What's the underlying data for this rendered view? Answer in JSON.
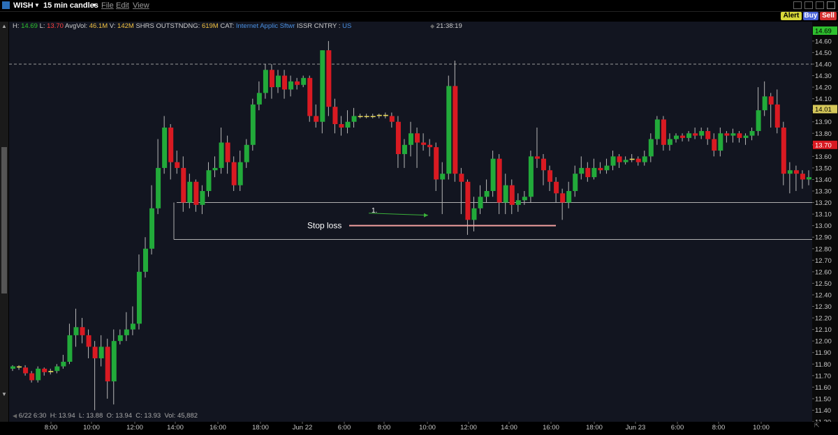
{
  "titlebar": {
    "symbol": "WISH",
    "interval": "15 min candles",
    "menus": [
      "File",
      "Edit",
      "View"
    ]
  },
  "actions": {
    "alert": "Alert",
    "buy": "Buy",
    "sell": "Sell"
  },
  "info": {
    "h_label": "H:",
    "h": "14.69",
    "l_label": "L:",
    "l": "13.70",
    "avgvol_label": "AvgVol:",
    "avgvol": "46.1M",
    "v_label": "V:",
    "v": "142M",
    "shrs_label": "SHRS OUTSTNDNG:",
    "shrs": "619M",
    "cat_label": "CAT:",
    "cat": "Internet Applic Sftwr",
    "issr_label": "ISSR CNTRY :",
    "issr": "US",
    "time": "21:38:19"
  },
  "bottom_info": {
    "date": "6/22 6:30",
    "h": "H: 13.94",
    "l": "L: 13.88",
    "o": "O: 13.94",
    "c": "C: 13.93",
    "vol": "Vol: 45,882"
  },
  "annotations": {
    "stop_loss": "Stop loss",
    "marker": "1."
  },
  "price_badges": {
    "high": "14.69",
    "current": "14.01",
    "low": "13.70"
  },
  "colors": {
    "up": "#22aa3a",
    "down": "#d91a22",
    "background": "#121520",
    "stop_line": "#f2a0a0",
    "high_badge": "#2ec02e",
    "current_badge": "#d6c85a",
    "low_badge": "#d91a22"
  },
  "chart_data": {
    "type": "candlestick",
    "ylim": [
      11.3,
      14.72
    ],
    "y_ticks": [
      "14.60",
      "14.50",
      "14.40",
      "14.30",
      "14.20",
      "14.10",
      "14.00",
      "13.90",
      "13.80",
      "13.70",
      "13.60",
      "13.50",
      "13.40",
      "13.30",
      "13.20",
      "13.10",
      "13.00",
      "12.90",
      "12.80",
      "12.70",
      "12.60",
      "12.50",
      "12.40",
      "12.30",
      "12.20",
      "12.10",
      "12.00",
      "11.90",
      "11.80",
      "11.70",
      "11.60",
      "11.50",
      "11.40",
      "11.30"
    ],
    "x_ticks": [
      "8:00",
      "10:00",
      "12:00",
      "14:00",
      "16:00",
      "18:00",
      "Jun 22",
      "6:00",
      "8:00",
      "10:00",
      "12:00",
      "14:00",
      "16:00",
      "18:00",
      "Jun 23",
      "6:00",
      "8:00",
      "10:00"
    ],
    "reference_lines": {
      "dashed_high": 14.4,
      "support_upper": 13.2,
      "support_lower": 12.88,
      "stop_loss": 13.0
    },
    "candles": [
      [
        11.76,
        11.78,
        11.74,
        11.79
      ],
      [
        11.78,
        11.77,
        11.75,
        11.79
      ],
      [
        11.77,
        11.72,
        11.7,
        11.79
      ],
      [
        11.72,
        11.66,
        11.64,
        11.74
      ],
      [
        11.66,
        11.76,
        11.64,
        11.78
      ],
      [
        11.76,
        11.73,
        11.7,
        11.77
      ],
      [
        11.73,
        11.74,
        11.71,
        11.76
      ],
      [
        11.74,
        11.78,
        11.72,
        11.8
      ],
      [
        11.78,
        11.82,
        11.76,
        11.88
      ],
      [
        11.82,
        12.05,
        11.8,
        12.15
      ],
      [
        12.05,
        12.12,
        11.95,
        12.28
      ],
      [
        12.12,
        12.05,
        11.98,
        12.2
      ],
      [
        12.05,
        11.95,
        11.85,
        12.1
      ],
      [
        11.95,
        11.85,
        11.4,
        12.0
      ],
      [
        11.85,
        11.95,
        11.78,
        12.05
      ],
      [
        11.95,
        11.65,
        11.5,
        12.02
      ],
      [
        11.65,
        12.0,
        11.45,
        12.1
      ],
      [
        12.0,
        12.05,
        11.97,
        12.1
      ],
      [
        12.05,
        12.1,
        12.0,
        12.25
      ],
      [
        12.1,
        12.15,
        12.05,
        12.3
      ],
      [
        12.15,
        12.6,
        12.1,
        12.75
      ],
      [
        12.6,
        12.8,
        12.55,
        12.9
      ],
      [
        12.8,
        13.15,
        12.75,
        13.35
      ],
      [
        13.15,
        13.5,
        13.1,
        13.75
      ],
      [
        13.5,
        13.85,
        13.45,
        13.95
      ],
      [
        13.85,
        13.55,
        13.4,
        13.88
      ],
      [
        13.55,
        13.5,
        13.45,
        13.65
      ],
      [
        13.5,
        13.2,
        13.12,
        13.6
      ],
      [
        13.2,
        13.38,
        13.15,
        13.45
      ],
      [
        13.38,
        13.18,
        13.12,
        13.4
      ],
      [
        13.18,
        13.3,
        13.1,
        13.35
      ],
      [
        13.3,
        13.48,
        13.25,
        13.55
      ],
      [
        13.48,
        13.5,
        13.42,
        13.6
      ],
      [
        13.5,
        13.72,
        13.45,
        13.85
      ],
      [
        13.72,
        13.55,
        13.45,
        13.78
      ],
      [
        13.55,
        13.35,
        13.3,
        13.6
      ],
      [
        13.35,
        13.55,
        13.3,
        13.65
      ],
      [
        13.55,
        13.7,
        13.5,
        13.75
      ],
      [
        13.7,
        14.05,
        13.65,
        14.1
      ],
      [
        14.05,
        14.15,
        14.0,
        14.25
      ],
      [
        14.15,
        14.35,
        14.1,
        14.4
      ],
      [
        14.35,
        14.2,
        14.1,
        14.4
      ],
      [
        14.2,
        14.3,
        14.15,
        14.35
      ],
      [
        14.3,
        14.18,
        14.1,
        14.35
      ],
      [
        14.18,
        14.25,
        14.12,
        14.3
      ],
      [
        14.25,
        14.22,
        14.18,
        14.28
      ],
      [
        14.22,
        14.28,
        14.2,
        14.3
      ],
      [
        14.28,
        13.95,
        13.9,
        14.3
      ],
      [
        13.95,
        13.9,
        13.85,
        14.05
      ],
      [
        13.9,
        14.52,
        13.8,
        14.52
      ],
      [
        14.52,
        14.03,
        13.95,
        14.6
      ],
      [
        14.03,
        13.88,
        13.8,
        14.1
      ],
      [
        13.88,
        13.85,
        13.78,
        13.95
      ],
      [
        13.85,
        13.9,
        13.8,
        14.0
      ],
      [
        13.9,
        13.95,
        13.85,
        14.02
      ],
      [
        13.95,
        13.95,
        13.93,
        13.97
      ],
      [
        13.95,
        13.95,
        13.93,
        13.97
      ],
      [
        13.95,
        13.95,
        13.93,
        13.97
      ],
      [
        13.95,
        13.96,
        13.93,
        13.97
      ],
      [
        13.96,
        13.95,
        13.93,
        13.98
      ],
      [
        13.95,
        13.9,
        13.85,
        13.98
      ],
      [
        13.9,
        13.62,
        13.5,
        13.95
      ],
      [
        13.62,
        13.7,
        13.5,
        13.75
      ],
      [
        13.7,
        13.8,
        13.6,
        13.9
      ],
      [
        13.8,
        13.72,
        13.5,
        13.85
      ],
      [
        13.72,
        13.7,
        13.65,
        13.8
      ],
      [
        13.7,
        13.68,
        13.6,
        13.75
      ],
      [
        13.68,
        13.4,
        13.3,
        13.72
      ],
      [
        13.4,
        13.45,
        13.1,
        13.55
      ],
      [
        13.45,
        14.21,
        13.4,
        14.3
      ],
      [
        14.21,
        13.45,
        13.38,
        14.43
      ],
      [
        13.45,
        13.38,
        13.1,
        13.5
      ],
      [
        13.38,
        13.05,
        12.92,
        13.4
      ],
      [
        13.05,
        13.15,
        12.95,
        13.25
      ],
      [
        13.15,
        13.25,
        13.1,
        13.35
      ],
      [
        13.25,
        13.3,
        13.2,
        13.4
      ],
      [
        13.3,
        13.58,
        13.25,
        13.65
      ],
      [
        13.58,
        13.2,
        13.1,
        13.62
      ],
      [
        13.2,
        13.35,
        13.1,
        13.45
      ],
      [
        13.35,
        13.18,
        13.1,
        13.4
      ],
      [
        13.18,
        13.22,
        13.12,
        13.28
      ],
      [
        13.22,
        13.25,
        13.18,
        13.3
      ],
      [
        13.25,
        13.6,
        13.2,
        13.65
      ],
      [
        13.6,
        13.58,
        13.5,
        13.85
      ],
      [
        13.58,
        13.48,
        13.35,
        13.62
      ],
      [
        13.48,
        13.38,
        13.3,
        13.52
      ],
      [
        13.38,
        13.28,
        13.2,
        13.42
      ],
      [
        13.28,
        13.2,
        13.05,
        13.32
      ],
      [
        13.2,
        13.3,
        13.15,
        13.38
      ],
      [
        13.3,
        13.45,
        13.25,
        13.52
      ],
      [
        13.45,
        13.5,
        13.4,
        13.6
      ],
      [
        13.5,
        13.42,
        13.38,
        13.55
      ],
      [
        13.42,
        13.5,
        13.4,
        13.58
      ],
      [
        13.5,
        13.48,
        13.45,
        13.55
      ],
      [
        13.48,
        13.52,
        13.45,
        13.58
      ],
      [
        13.52,
        13.6,
        13.48,
        13.65
      ],
      [
        13.6,
        13.55,
        13.5,
        13.62
      ],
      [
        13.55,
        13.57,
        13.53,
        13.6
      ],
      [
        13.57,
        13.58,
        13.55,
        13.62
      ],
      [
        13.58,
        13.55,
        13.52,
        13.6
      ],
      [
        13.55,
        13.6,
        13.52,
        13.65
      ],
      [
        13.6,
        13.75,
        13.55,
        13.8
      ],
      [
        13.75,
        13.92,
        13.7,
        13.95
      ],
      [
        13.92,
        13.7,
        13.65,
        13.95
      ],
      [
        13.7,
        13.75,
        13.65,
        13.8
      ],
      [
        13.75,
        13.78,
        13.72,
        13.8
      ],
      [
        13.78,
        13.76,
        13.73,
        13.8
      ],
      [
        13.76,
        13.8,
        13.73,
        13.82
      ],
      [
        13.8,
        13.78,
        13.75,
        13.85
      ],
      [
        13.78,
        13.82,
        13.75,
        13.85
      ],
      [
        13.82,
        13.75,
        13.7,
        13.85
      ],
      [
        13.75,
        13.65,
        13.6,
        13.8
      ],
      [
        13.65,
        13.8,
        13.6,
        13.85
      ],
      [
        13.8,
        13.78,
        13.72,
        13.82
      ],
      [
        13.78,
        13.8,
        13.72,
        13.84
      ],
      [
        13.8,
        13.76,
        13.72,
        13.82
      ],
      [
        13.76,
        13.78,
        13.7,
        13.8
      ],
      [
        13.78,
        13.82,
        13.74,
        13.85
      ],
      [
        13.82,
        14.0,
        13.78,
        14.2
      ],
      [
        14.0,
        14.12,
        13.95,
        14.25
      ],
      [
        14.12,
        14.05,
        13.85,
        14.15
      ],
      [
        14.05,
        13.85,
        13.8,
        14.18
      ],
      [
        13.85,
        13.45,
        13.35,
        13.9
      ],
      [
        13.45,
        13.48,
        13.28,
        13.55
      ],
      [
        13.48,
        13.45,
        13.3,
        13.52
      ],
      [
        13.45,
        13.4,
        13.32,
        13.48
      ],
      [
        13.4,
        13.42,
        13.35,
        13.48
      ]
    ]
  }
}
